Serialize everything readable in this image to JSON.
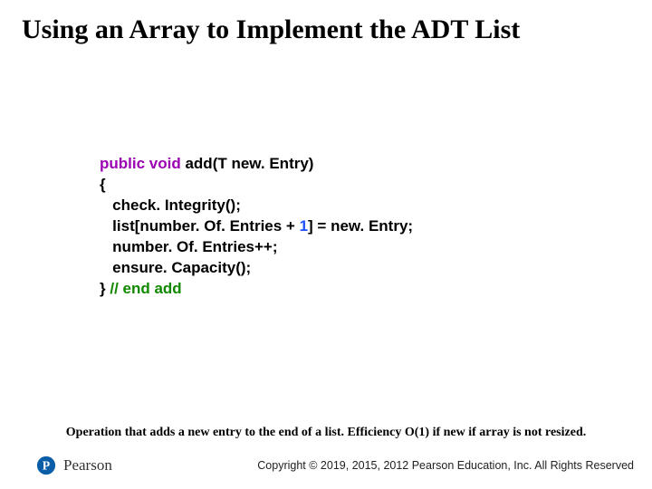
{
  "title": "Using an Array to Implement the ADT List",
  "code": {
    "kw_public": "public",
    "kw_void": "void",
    "sig_rest": " add(T new. Entry)",
    "open_brace": "{",
    "l1": "   check. Integrity();",
    "l2a": "   list[number. Of. Entries + ",
    "l2num": "1",
    "l2b": "] = new. Entry;",
    "l3": "   number. Of. Entries++;",
    "l4": "   ensure. Capacity();",
    "close_brace": "} ",
    "end_comment": "// end add"
  },
  "caption": "Operation that adds a new entry to the end of a list. Efficiency O(1) if new if array is not resized.",
  "footer": {
    "brand": "Pearson",
    "copyright": "Copyright © 2019, 2015, 2012 Pearson Education, Inc. All Rights Reserved"
  }
}
